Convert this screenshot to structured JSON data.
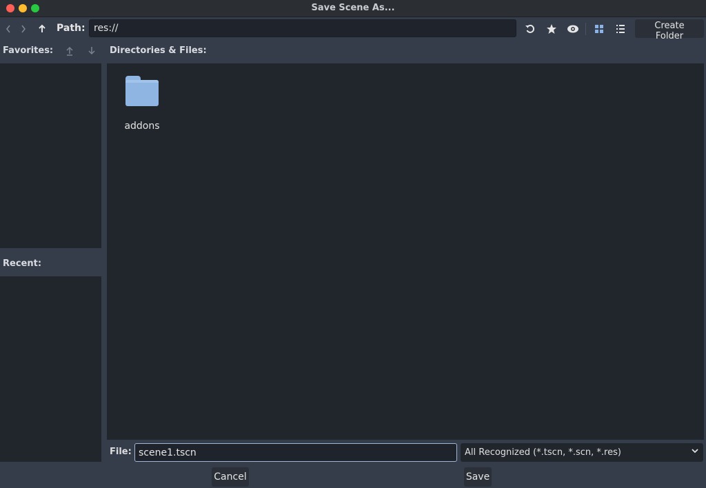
{
  "window": {
    "title": "Save Scene As..."
  },
  "toolbar": {
    "back_icon": "chevron-left-icon",
    "forward_icon": "chevron-right-icon",
    "up_icon": "arrow-up-icon",
    "path_label": "Path:",
    "path_value": "res://",
    "refresh_icon": "refresh-icon",
    "favorite_icon": "star-icon",
    "hidden_icon": "eye-icon",
    "grid_view_icon": "grid-icon",
    "list_view_icon": "list-icon",
    "create_folder_label": "Create Folder"
  },
  "sidebar": {
    "favorites_label": "Favorites:",
    "recent_label": "Recent:"
  },
  "files": {
    "heading": "Directories & Files:",
    "items": [
      {
        "name": "addons",
        "icon": "folder-icon"
      }
    ]
  },
  "footer": {
    "file_label": "File:",
    "file_value": "scene1.tscn",
    "filter_value": "All Recognized (*.tscn, *.scn, *.res)",
    "cancel_label": "Cancel",
    "save_label": "Save"
  },
  "colors": {
    "background": "#363d4a",
    "panel": "#21252c",
    "folder": "#8fb6e3",
    "focus_border": "#9fb8d8"
  }
}
